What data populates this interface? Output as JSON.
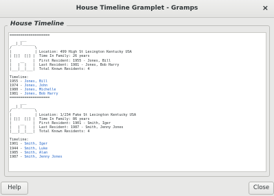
{
  "window": {
    "title": "House Timeline Gramplet - Gramps",
    "close_glyph": "×"
  },
  "frame_label": "House Timeline",
  "content": {
    "houses": [
      {
        "divider": "===================",
        "art": [
          "     ___",
          " __|_|______",
          "/           \\",
          "|           |",
          "| [|]  [|] |",
          "|    __    |",
          "|   |  |   |",
          "|___|__|___|"
        ],
        "info": [
          "Location: 499 High St Lexington Kentucky USA",
          "Time In Family: 26 years",
          "First Resident: 1955 - Jones, Bill",
          "Last Resident: 1981 - Jones, Bob Harry",
          "Total Known Residents: 4"
        ],
        "timeline_label": "Timeline:",
        "timeline": [
          {
            "year": "1955",
            "name": "Jones, Bill"
          },
          {
            "year": "1974",
            "name": "Jones, John"
          },
          {
            "year": "1980",
            "name": "Jones, Michelle"
          },
          {
            "year": "1981",
            "name": "Jones, Bob Harry"
          }
        ]
      },
      {
        "divider": "===================",
        "art": [
          "     ___",
          " __|_|______",
          "/           \\",
          "|           |",
          "| [|]  [|] |",
          "|    __    |",
          "|   |  |   |",
          "|___|__|___|"
        ],
        "info": [
          "Location: 1/234 Fake St Lexington Kentucky USA",
          "Time In Family: 86 years",
          "First Resident: 1901 - Smith, Iger",
          "Last Resident: 1987 - Smith, Jenny Jones",
          "Total Known Residents: 4"
        ],
        "timeline_label": "Timeline:",
        "timeline": [
          {
            "year": "1901",
            "name": "Smith, Iger"
          },
          {
            "year": "1944",
            "name": "Smith, Luke"
          },
          {
            "year": "1985",
            "name": "Smith, Alan"
          },
          {
            "year": "1987",
            "name": "Smith, Jenny Jones"
          }
        ]
      }
    ]
  },
  "buttons": {
    "help": "Help",
    "close": "Close"
  }
}
